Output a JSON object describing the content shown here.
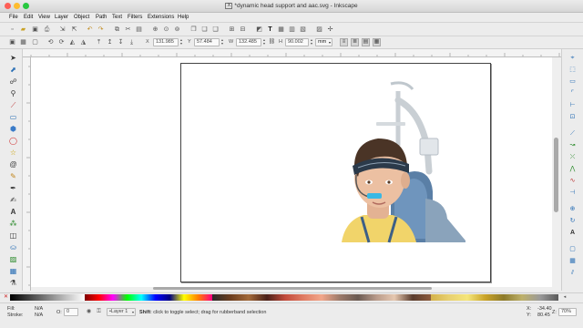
{
  "window": {
    "title": "*dynamic head support and aac.svg - Inkscape",
    "traffic_lights": {
      "close": "#fe5f57",
      "minimize": "#febc2e",
      "maximize": "#28c840"
    }
  },
  "menu": [
    "File",
    "Edit",
    "View",
    "Layer",
    "Object",
    "Path",
    "Text",
    "Filters",
    "Extensions",
    "Help"
  ],
  "select_toolbar": {
    "x_label": "X",
    "x_value": "131.985",
    "y_label": "Y",
    "y_value": "57.484",
    "w_label": "W",
    "w_value": "132.485",
    "lock_icon": "chain-lock-icon",
    "h_label": "H",
    "h_value": "90.002",
    "unit": "mm"
  },
  "status": {
    "fill_label": "Fill:",
    "fill_value": "N/A",
    "stroke_label": "Stroke:",
    "stroke_value": "N/A",
    "opacity_label": "O:",
    "opacity_value": "0",
    "layer": "•Layer 1",
    "message_bold": "Shift",
    "message": ": click to toggle select; drag for rubberband selection",
    "x_label": "X:",
    "x_value": "-34.40",
    "y_label": "Y:",
    "y_value": "80.45",
    "zoom_label": "Z:",
    "zoom_value": "70%"
  },
  "colors": {
    "accent": "#2a6fb5",
    "page_border": "#444444"
  }
}
